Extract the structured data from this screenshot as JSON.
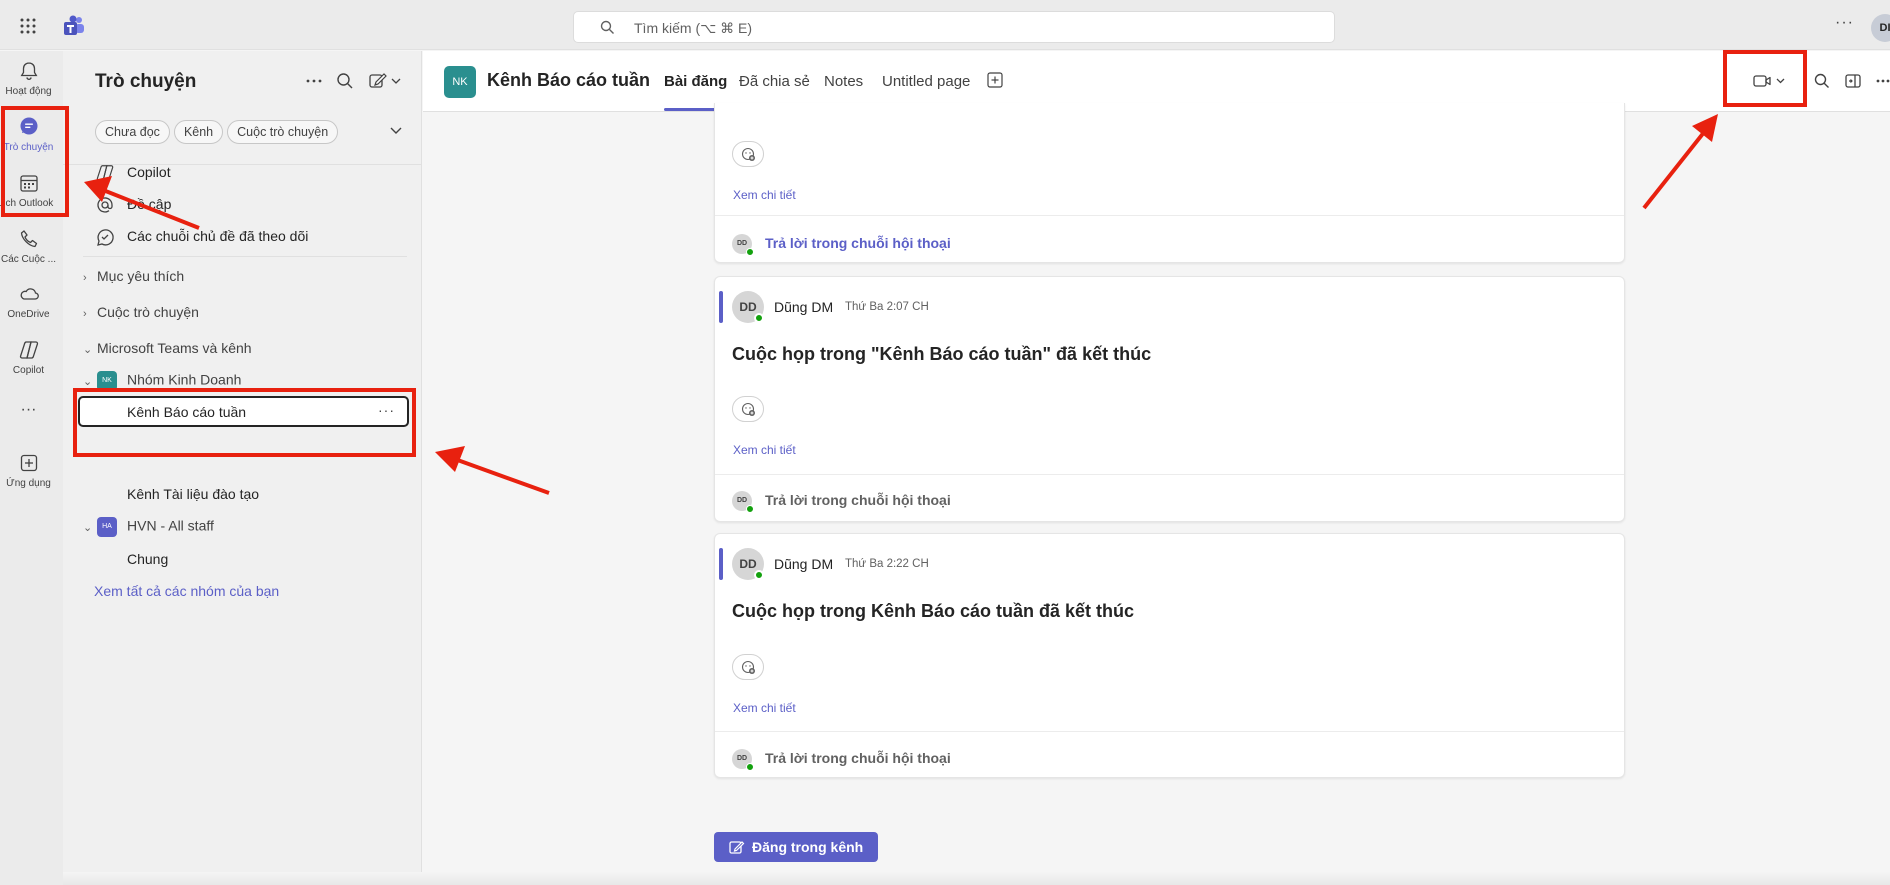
{
  "topbar": {
    "search_placeholder": "Tìm kiếm (⌥ ⌘ E)",
    "more": "···",
    "avatar_initials": "DI"
  },
  "rail": {
    "items": [
      {
        "label": "Hoạt động",
        "icon": "bell-icon"
      },
      {
        "label": "Trò chuyện",
        "icon": "chat-icon"
      },
      {
        "label": "Lịch Outlook",
        "icon": "calendar-icon"
      },
      {
        "label": "Các Cuộc ...",
        "icon": "phone-icon"
      },
      {
        "label": "OneDrive",
        "icon": "cloud-icon"
      },
      {
        "label": "Copilot",
        "icon": "copilot-icon"
      },
      {
        "label": "···",
        "icon": "more-icon"
      },
      {
        "label": "Ứng dụng",
        "icon": "add-apps-icon"
      }
    ]
  },
  "left_panel": {
    "title": "Trò chuyện",
    "filters": [
      "Chưa đọc",
      "Kênh",
      "Cuộc trò chuyện"
    ],
    "quick_items": [
      "Copilot",
      "Đề cập",
      "Các chuỗi chủ đề đã theo dõi"
    ],
    "sections": {
      "favorites": "Mục yêu thích",
      "chats": "Cuộc trò chuyện",
      "teams": "Microsoft Teams và kênh"
    },
    "teams": [
      {
        "name": "Nhóm Kinh Doanh",
        "badge": "NK",
        "color": "#2a8f8f",
        "channels": [
          "Kênh Báo cáo tuần",
          "Kênh Tài liệu đào tạo"
        ]
      },
      {
        "name": "HVN - All staff",
        "badge": "HA",
        "color": "#5b5fc7",
        "channels": [
          "Chung"
        ]
      }
    ],
    "selected_channel_more": "···",
    "see_all": "Xem tất cả các nhóm của bạn"
  },
  "channel_header": {
    "avatar": "NK",
    "title": "Kênh Báo cáo tuần",
    "tabs": [
      "Bài đăng",
      "Đã chia sẻ",
      "Notes",
      "Untitled page"
    ],
    "active_tab": "Bài đăng"
  },
  "posts": [
    {
      "details_link": "Xem chi tiết",
      "reply_avatar": "DD",
      "reply_label": "Trả lời trong chuỗi hội thoại"
    },
    {
      "avatar": "DD",
      "author": "Dũng DM",
      "time": "Thứ Ba 2:07 CH",
      "title": "Cuộc họp trong \"Kênh Báo cáo tuần\" đã kết thúc",
      "details_link": "Xem chi tiết",
      "reply_avatar": "DD",
      "reply_label": "Trả lời trong chuỗi hội thoại"
    },
    {
      "avatar": "DD",
      "author": "Dũng DM",
      "time": "Thứ Ba 2:22 CH",
      "title": "Cuộc họp trong Kênh Báo cáo tuần đã kết thúc",
      "details_link": "Xem chi tiết",
      "reply_avatar": "DD",
      "reply_label": "Trả lời trong chuỗi hội thoại"
    }
  ],
  "compose_button": "Đăng trong kênh",
  "colors": {
    "accent": "#5b5fc7",
    "annotation_red": "#e8210f",
    "presence_green": "#13a10e"
  }
}
